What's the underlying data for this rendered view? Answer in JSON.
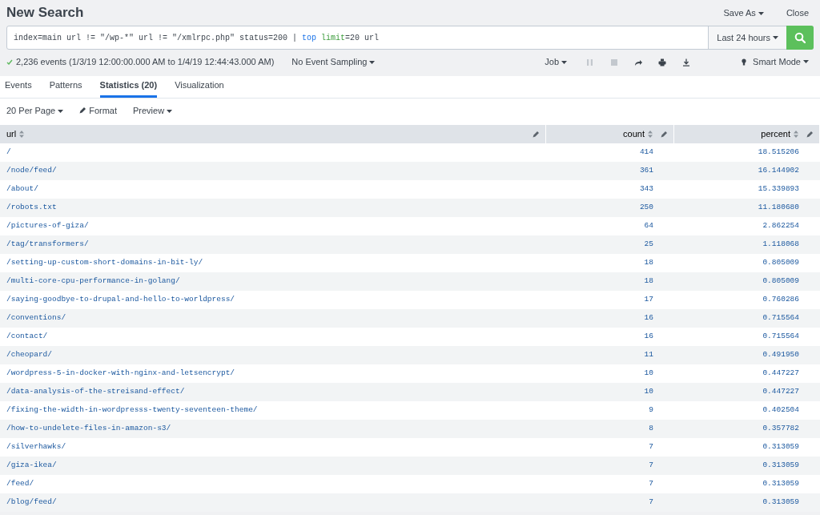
{
  "title": "New Search",
  "header_actions": [
    {
      "label": "Save As",
      "dropdown": true
    },
    {
      "label": "Close",
      "dropdown": false
    }
  ],
  "search": {
    "query": [
      {
        "kind": "plain",
        "text": "index=main url != \"/wp-*\" url != \"/xmlrpc.php\" status=200 | "
      },
      {
        "kind": "command",
        "text": "top"
      },
      {
        "kind": "argument",
        "text": " limit"
      },
      {
        "kind": "plain",
        "text": "=20 url"
      }
    ],
    "time_range": "Last 24 hours"
  },
  "status": {
    "summary": "2,236 events (1/3/19 12:00:00.000 AM to 1/4/19 12:44:43.000 AM)",
    "sampling": "No Event Sampling",
    "job": "Job",
    "job_controls": [
      {
        "kind": "pause",
        "disabled": true
      },
      {
        "kind": "stop",
        "disabled": true
      },
      {
        "kind": "share",
        "disabled": false
      },
      {
        "kind": "print",
        "disabled": false
      },
      {
        "kind": "export",
        "disabled": false
      }
    ],
    "mode": "Smart Mode"
  },
  "tabs": [
    {
      "label": "Events",
      "selected": false
    },
    {
      "label": "Patterns",
      "selected": false
    },
    {
      "label": "Statistics (20)",
      "selected": true
    },
    {
      "label": "Visualization",
      "selected": false
    }
  ],
  "toolbar": {
    "per_page": "20 Per Page",
    "format": "Format",
    "preview": "Preview"
  },
  "table": {
    "columns": [
      {
        "label": "url"
      },
      {
        "label": "count"
      },
      {
        "label": "percent"
      }
    ],
    "rows": [
      [
        "/",
        "414",
        "18.515206"
      ],
      [
        "/node/feed/",
        "361",
        "16.144902"
      ],
      [
        "/about/",
        "343",
        "15.339893"
      ],
      [
        "/robots.txt",
        "250",
        "11.180680"
      ],
      [
        "/pictures-of-giza/",
        "64",
        "2.862254"
      ],
      [
        "/tag/transformers/",
        "25",
        "1.118068"
      ],
      [
        "/setting-up-custom-short-domains-in-bit-ly/",
        "18",
        "0.805009"
      ],
      [
        "/multi-core-cpu-performance-in-golang/",
        "18",
        "0.805009"
      ],
      [
        "/saying-goodbye-to-drupal-and-hello-to-worldpress/",
        "17",
        "0.760286"
      ],
      [
        "/conventions/",
        "16",
        "0.715564"
      ],
      [
        "/contact/",
        "16",
        "0.715564"
      ],
      [
        "/cheopard/",
        "11",
        "0.491950"
      ],
      [
        "/wordpress-5-in-docker-with-nginx-and-letsencrypt/",
        "10",
        "0.447227"
      ],
      [
        "/data-analysis-of-the-streisand-effect/",
        "10",
        "0.447227"
      ],
      [
        "/fixing-the-width-in-wordpresss-twenty-seventeen-theme/",
        "9",
        "0.402504"
      ],
      [
        "/how-to-undelete-files-in-amazon-s3/",
        "8",
        "0.357782"
      ],
      [
        "/silverhawks/",
        "7",
        "0.313059"
      ],
      [
        "/giza-ikea/",
        "7",
        "0.313059"
      ],
      [
        "/feed/",
        "7",
        "0.313059"
      ],
      [
        "/blog/feed/",
        "7",
        "0.313059"
      ]
    ]
  }
}
